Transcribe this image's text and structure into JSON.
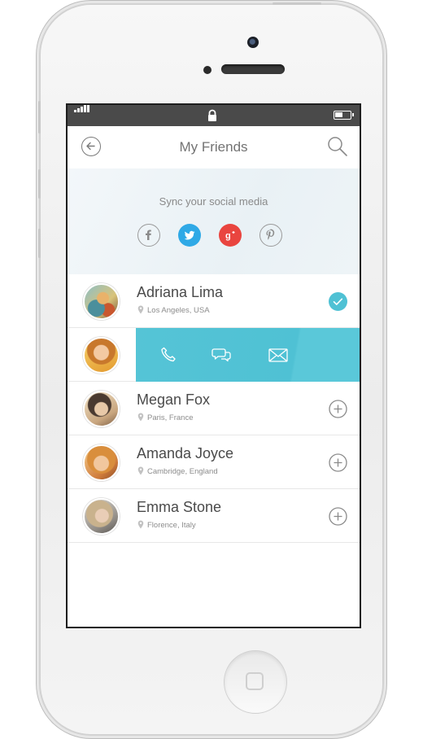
{
  "header": {
    "title": "My Friends"
  },
  "sync": {
    "label": "Sync your social media"
  },
  "colors": {
    "accent": "#4fc1d4",
    "twitter": "#2fa9e6",
    "google_plus": "#e9453f"
  },
  "friends": [
    {
      "name": "Adriana Lima",
      "location": "Los Angeles, USA",
      "status": "selected"
    },
    {
      "name": "",
      "location": "",
      "status": "swiped-actions",
      "actions": [
        "phone-icon",
        "chat-icon",
        "mail-icon"
      ]
    },
    {
      "name": "Megan Fox",
      "location": "Paris, France",
      "status": "add"
    },
    {
      "name": "Amanda Joyce",
      "location": "Cambridge, England",
      "status": "add"
    },
    {
      "name": "Emma Stone",
      "location": "Florence, Italy",
      "status": "add"
    }
  ]
}
